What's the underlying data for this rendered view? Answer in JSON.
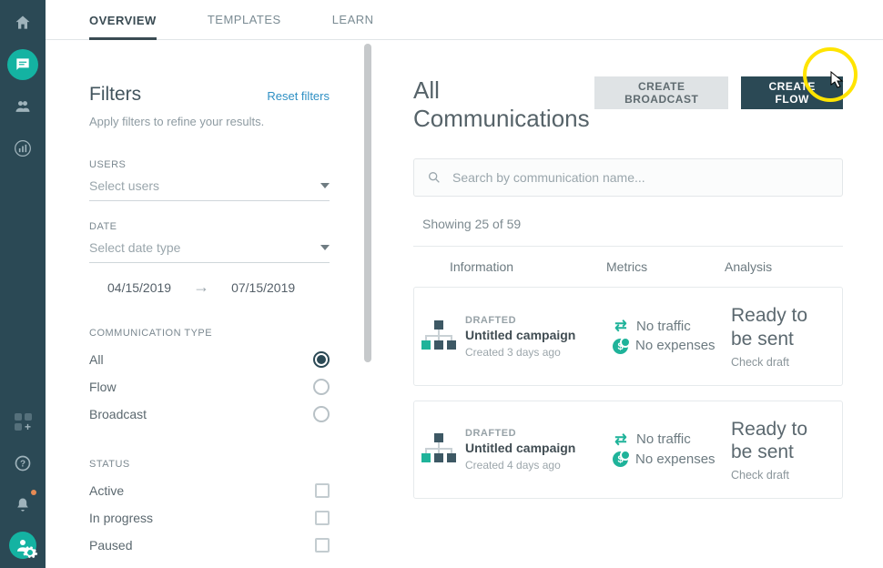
{
  "tabs": {
    "overview": "Overview",
    "templates": "Templates",
    "learn": "Learn"
  },
  "filters": {
    "title": "Filters",
    "reset": "Reset filters",
    "sub": "Apply filters to refine your results.",
    "users_label": "Users",
    "users_placeholder": "Select users",
    "date_label": "Date",
    "date_placeholder": "Select date type",
    "date_from": "04/15/2019",
    "date_to": "07/15/2019",
    "comm_type_label": "Communication Type",
    "comm_types": {
      "all": "All",
      "flow": "Flow",
      "broadcast": "Broadcast"
    },
    "status_label": "Status",
    "statuses": {
      "active": "Active",
      "in_progress": "In progress",
      "paused": "Paused"
    }
  },
  "content": {
    "title": "All Communications",
    "create_broadcast": "Create Broadcast",
    "create_flow": "Create Flow",
    "search_placeholder": "Search by communication name...",
    "showing": "Showing 25 of 59",
    "cols": {
      "info": "Information",
      "metrics": "Metrics",
      "analysis": "Analysis"
    }
  },
  "metrics": {
    "no_traffic": "No traffic",
    "no_expenses": "No expenses"
  },
  "analysis": {
    "ready": "Ready to be sent",
    "check": "Check draft"
  },
  "rows": [
    {
      "status": "DRAFTED",
      "title": "Untitled campaign",
      "created": "Created 3 days ago"
    },
    {
      "status": "DRAFTED",
      "title": "Untitled campaign",
      "created": "Created 4 days ago"
    }
  ]
}
